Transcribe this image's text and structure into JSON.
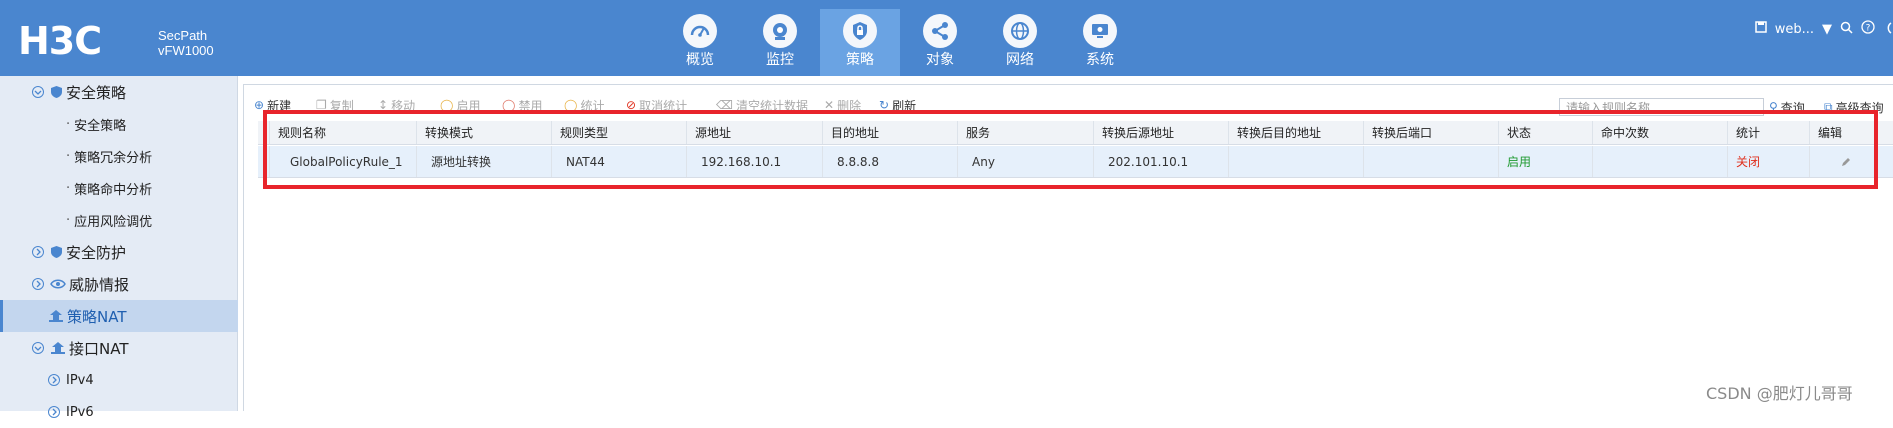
{
  "header": {
    "logo": "H3C",
    "product_line1": "SecPath",
    "product_line2": "vFW1000",
    "nav": [
      {
        "label": "概览",
        "icon": "dashboard-icon"
      },
      {
        "label": "监控",
        "icon": "camera-icon"
      },
      {
        "label": "策略",
        "icon": "shield-icon",
        "active": true
      },
      {
        "label": "对象",
        "icon": "share-nodes-icon"
      },
      {
        "label": "网络",
        "icon": "globe-icon"
      },
      {
        "label": "系统",
        "icon": "monitor-icon"
      }
    ],
    "user": "web...",
    "accent": "#4a86cf"
  },
  "sidebar": {
    "items": [
      {
        "label": "安全策略",
        "level": 1,
        "icon": "shield-icon"
      },
      {
        "label": "安全策略",
        "level": 2
      },
      {
        "label": "策略冗余分析",
        "level": 2
      },
      {
        "label": "策略命中分析",
        "level": 2
      },
      {
        "label": "应用风险调优",
        "level": 2
      },
      {
        "label": "安全防护",
        "level": 1,
        "icon": "shield-icon"
      },
      {
        "label": "威胁情报",
        "level": 1,
        "icon": "eye-icon"
      },
      {
        "label": "策略NAT",
        "level": 1,
        "icon": "nat-icon",
        "active": true
      },
      {
        "label": "接口NAT",
        "level": 1,
        "icon": "nat-icon"
      },
      {
        "label": "IPv4",
        "level": 2
      },
      {
        "label": "IPv6",
        "level": 2
      }
    ]
  },
  "toolbar": {
    "buttons": [
      "新建",
      "复制",
      "移动",
      "启用",
      "禁用",
      "统计",
      "取消统计",
      "清空统计数据",
      "删除",
      "刷新"
    ],
    "search_placeholder": "请输入规则名称",
    "query": "查询",
    "advanced": "高级查询"
  },
  "table": {
    "columns": [
      "规则名称",
      "转换模式",
      "规则类型",
      "源地址",
      "目的地址",
      "服务",
      "转换后源地址",
      "转换后目的地址",
      "转换后端口",
      "状态",
      "命中次数",
      "统计",
      "编辑"
    ],
    "rows": [
      {
        "name": "GlobalPolicyRule_1",
        "mode": "源地址转换",
        "type": "NAT44",
        "src": "192.168.10.1",
        "dst": "8.8.8.8",
        "service": "Any",
        "trans_src": "202.101.10.1",
        "trans_dst": "",
        "trans_port": "",
        "status": "启用",
        "hits": "",
        "stats": "关闭"
      }
    ]
  },
  "watermark": "CSDN @肥灯儿哥哥"
}
